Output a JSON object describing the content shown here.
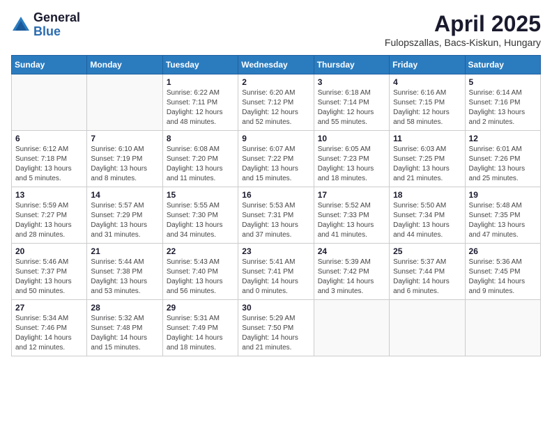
{
  "header": {
    "logo_general": "General",
    "logo_blue": "Blue",
    "title": "April 2025",
    "location": "Fulopszallas, Bacs-Kiskun, Hungary"
  },
  "weekdays": [
    "Sunday",
    "Monday",
    "Tuesday",
    "Wednesday",
    "Thursday",
    "Friday",
    "Saturday"
  ],
  "weeks": [
    [
      {
        "day": "",
        "info": ""
      },
      {
        "day": "",
        "info": ""
      },
      {
        "day": "1",
        "info": "Sunrise: 6:22 AM\nSunset: 7:11 PM\nDaylight: 12 hours\nand 48 minutes."
      },
      {
        "day": "2",
        "info": "Sunrise: 6:20 AM\nSunset: 7:12 PM\nDaylight: 12 hours\nand 52 minutes."
      },
      {
        "day": "3",
        "info": "Sunrise: 6:18 AM\nSunset: 7:14 PM\nDaylight: 12 hours\nand 55 minutes."
      },
      {
        "day": "4",
        "info": "Sunrise: 6:16 AM\nSunset: 7:15 PM\nDaylight: 12 hours\nand 58 minutes."
      },
      {
        "day": "5",
        "info": "Sunrise: 6:14 AM\nSunset: 7:16 PM\nDaylight: 13 hours\nand 2 minutes."
      }
    ],
    [
      {
        "day": "6",
        "info": "Sunrise: 6:12 AM\nSunset: 7:18 PM\nDaylight: 13 hours\nand 5 minutes."
      },
      {
        "day": "7",
        "info": "Sunrise: 6:10 AM\nSunset: 7:19 PM\nDaylight: 13 hours\nand 8 minutes."
      },
      {
        "day": "8",
        "info": "Sunrise: 6:08 AM\nSunset: 7:20 PM\nDaylight: 13 hours\nand 11 minutes."
      },
      {
        "day": "9",
        "info": "Sunrise: 6:07 AM\nSunset: 7:22 PM\nDaylight: 13 hours\nand 15 minutes."
      },
      {
        "day": "10",
        "info": "Sunrise: 6:05 AM\nSunset: 7:23 PM\nDaylight: 13 hours\nand 18 minutes."
      },
      {
        "day": "11",
        "info": "Sunrise: 6:03 AM\nSunset: 7:25 PM\nDaylight: 13 hours\nand 21 minutes."
      },
      {
        "day": "12",
        "info": "Sunrise: 6:01 AM\nSunset: 7:26 PM\nDaylight: 13 hours\nand 25 minutes."
      }
    ],
    [
      {
        "day": "13",
        "info": "Sunrise: 5:59 AM\nSunset: 7:27 PM\nDaylight: 13 hours\nand 28 minutes."
      },
      {
        "day": "14",
        "info": "Sunrise: 5:57 AM\nSunset: 7:29 PM\nDaylight: 13 hours\nand 31 minutes."
      },
      {
        "day": "15",
        "info": "Sunrise: 5:55 AM\nSunset: 7:30 PM\nDaylight: 13 hours\nand 34 minutes."
      },
      {
        "day": "16",
        "info": "Sunrise: 5:53 AM\nSunset: 7:31 PM\nDaylight: 13 hours\nand 37 minutes."
      },
      {
        "day": "17",
        "info": "Sunrise: 5:52 AM\nSunset: 7:33 PM\nDaylight: 13 hours\nand 41 minutes."
      },
      {
        "day": "18",
        "info": "Sunrise: 5:50 AM\nSunset: 7:34 PM\nDaylight: 13 hours\nand 44 minutes."
      },
      {
        "day": "19",
        "info": "Sunrise: 5:48 AM\nSunset: 7:35 PM\nDaylight: 13 hours\nand 47 minutes."
      }
    ],
    [
      {
        "day": "20",
        "info": "Sunrise: 5:46 AM\nSunset: 7:37 PM\nDaylight: 13 hours\nand 50 minutes."
      },
      {
        "day": "21",
        "info": "Sunrise: 5:44 AM\nSunset: 7:38 PM\nDaylight: 13 hours\nand 53 minutes."
      },
      {
        "day": "22",
        "info": "Sunrise: 5:43 AM\nSunset: 7:40 PM\nDaylight: 13 hours\nand 56 minutes."
      },
      {
        "day": "23",
        "info": "Sunrise: 5:41 AM\nSunset: 7:41 PM\nDaylight: 14 hours\nand 0 minutes."
      },
      {
        "day": "24",
        "info": "Sunrise: 5:39 AM\nSunset: 7:42 PM\nDaylight: 14 hours\nand 3 minutes."
      },
      {
        "day": "25",
        "info": "Sunrise: 5:37 AM\nSunset: 7:44 PM\nDaylight: 14 hours\nand 6 minutes."
      },
      {
        "day": "26",
        "info": "Sunrise: 5:36 AM\nSunset: 7:45 PM\nDaylight: 14 hours\nand 9 minutes."
      }
    ],
    [
      {
        "day": "27",
        "info": "Sunrise: 5:34 AM\nSunset: 7:46 PM\nDaylight: 14 hours\nand 12 minutes."
      },
      {
        "day": "28",
        "info": "Sunrise: 5:32 AM\nSunset: 7:48 PM\nDaylight: 14 hours\nand 15 minutes."
      },
      {
        "day": "29",
        "info": "Sunrise: 5:31 AM\nSunset: 7:49 PM\nDaylight: 14 hours\nand 18 minutes."
      },
      {
        "day": "30",
        "info": "Sunrise: 5:29 AM\nSunset: 7:50 PM\nDaylight: 14 hours\nand 21 minutes."
      },
      {
        "day": "",
        "info": ""
      },
      {
        "day": "",
        "info": ""
      },
      {
        "day": "",
        "info": ""
      }
    ]
  ]
}
